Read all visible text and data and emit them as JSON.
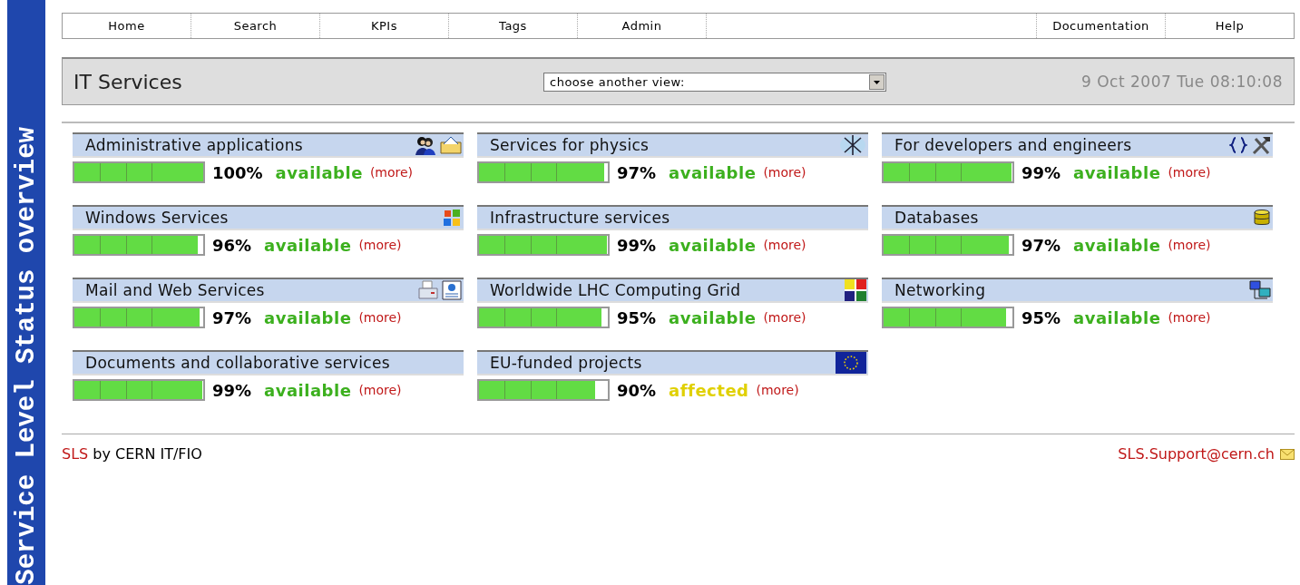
{
  "sidebar": {
    "title": "Service Level Status overview"
  },
  "nav": {
    "left": [
      "Home",
      "Search",
      "KPIs",
      "Tags",
      "Admin"
    ],
    "right": [
      "Documentation",
      "Help"
    ]
  },
  "header": {
    "title": "IT Services",
    "view_select": {
      "value": "choose another view:"
    },
    "datetime": "9 Oct 2007 Tue 08:10:08"
  },
  "services": [
    {
      "title": "Administrative applications",
      "level": 1.0,
      "percent": "100%",
      "status": "available",
      "color": "#3cb01e",
      "more": "(more)",
      "icons": [
        {
          "kind": "people"
        },
        {
          "kind": "folder"
        }
      ]
    },
    {
      "title": "Services for physics",
      "level": 0.97,
      "percent": "97%",
      "status": "available",
      "color": "#3cb01e",
      "more": "(more)",
      "icons": [
        {
          "kind": "atom"
        }
      ]
    },
    {
      "title": "For developers and engineers",
      "level": 0.99,
      "percent": "99%",
      "status": "available",
      "color": "#3cb01e",
      "more": "(more)",
      "icons": [
        {
          "kind": "braces"
        },
        {
          "kind": "tools"
        }
      ]
    },
    {
      "title": "Windows Services",
      "level": 0.96,
      "percent": "96%",
      "status": "available",
      "color": "#3cb01e",
      "more": "(more)",
      "icons": [
        {
          "kind": "windows"
        }
      ]
    },
    {
      "title": "Infrastructure services",
      "level": 0.99,
      "percent": "99%",
      "status": "available",
      "color": "#3cb01e",
      "more": "(more)"
    },
    {
      "title": "Databases",
      "level": 0.97,
      "percent": "97%",
      "status": "available",
      "color": "#3cb01e",
      "more": "(more)",
      "icons": [
        {
          "kind": "database"
        }
      ]
    },
    {
      "title": "Mail and Web Services",
      "level": 0.97,
      "percent": "97%",
      "status": "available",
      "color": "#3cb01e",
      "more": "(more)",
      "icons": [
        {
          "kind": "printer"
        },
        {
          "kind": "webpage"
        }
      ]
    },
    {
      "title": "Worldwide LHC Computing Grid",
      "level": 0.95,
      "percent": "95%",
      "status": "available",
      "color": "#3cb01e",
      "more": "(more)",
      "icons": [
        {
          "kind": "grid"
        }
      ]
    },
    {
      "title": "Networking",
      "level": 0.95,
      "percent": "95%",
      "status": "available",
      "color": "#3cb01e",
      "more": "(more)",
      "icons": [
        {
          "kind": "network"
        }
      ]
    },
    {
      "title": "Documents and collaborative services",
      "level": 0.99,
      "percent": "99%",
      "status": "available",
      "color": "#3cb01e",
      "more": "(more)"
    },
    {
      "title": "EU-funded projects",
      "level": 0.9,
      "percent": "90%",
      "status": "affected",
      "color": "#e0d000",
      "more": "(more)",
      "icons": [
        {
          "kind": "eu-flag"
        }
      ]
    }
  ],
  "footer": {
    "link": "SLS",
    "text": "by CERN IT/FIO",
    "email": "SLS.Support@cern.ch"
  }
}
